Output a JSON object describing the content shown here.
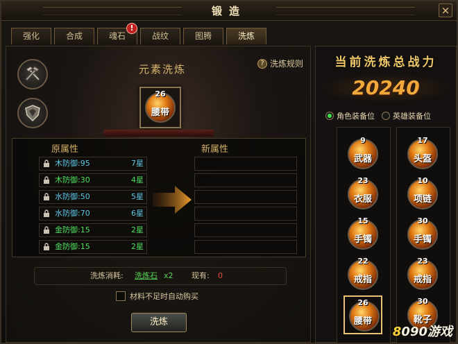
{
  "window": {
    "title": "锻造",
    "close_label": "×"
  },
  "tabs": [
    {
      "label": "强化",
      "active": false
    },
    {
      "label": "合成",
      "active": false
    },
    {
      "label": "魂石",
      "active": false,
      "alert": "!"
    },
    {
      "label": "战纹",
      "active": false
    },
    {
      "label": "图腾",
      "active": false
    },
    {
      "label": "洗炼",
      "active": true
    }
  ],
  "left": {
    "heading": "元素洗炼",
    "rules_q": "?",
    "rules_label": "洗炼规则",
    "center_item": {
      "level": "26",
      "name": "腰带"
    },
    "original_header": "原属性",
    "new_header": "新属性",
    "attributes": [
      {
        "text": "木防御:95",
        "stars": "7星",
        "color": "cyan"
      },
      {
        "text": "木防御:30",
        "stars": "4星",
        "color": "green"
      },
      {
        "text": "水防御:50",
        "stars": "5星",
        "color": "cyan"
      },
      {
        "text": "水防御:70",
        "stars": "6星",
        "color": "cyan"
      },
      {
        "text": "金防御:15",
        "stars": "2星",
        "color": "green"
      },
      {
        "text": "金防御:15",
        "stars": "2星",
        "color": "green"
      }
    ],
    "cost_label": "洗炼消耗:",
    "cost_item": "洗炼石",
    "cost_mult": "x2",
    "own_label": "现有:",
    "own_value": "0",
    "auto_buy_label": "材料不足时自动购买",
    "refine_button": "洗炼"
  },
  "right": {
    "power_title": "当前洗炼总战力",
    "power_value": "20240",
    "radio_role": "角色装备位",
    "radio_hero": "英雄装备位",
    "left_column": [
      {
        "level": "9",
        "name": "武器"
      },
      {
        "level": "23",
        "name": "衣服"
      },
      {
        "level": "15",
        "name": "手镯"
      },
      {
        "level": "22",
        "name": "戒指"
      },
      {
        "level": "26",
        "name": "腰带",
        "selected": true
      }
    ],
    "right_column": [
      {
        "level": "17",
        "name": "头盔"
      },
      {
        "level": "10",
        "name": "项链"
      },
      {
        "level": "30",
        "name": "手镯"
      },
      {
        "level": "23",
        "name": "戒指"
      },
      {
        "level": "30",
        "name": "靴子"
      }
    ]
  },
  "watermark": {
    "eight": "8",
    "rest": "090游戏"
  },
  "colors": {
    "gold": "#f0a93a",
    "cyan": "#5ec8e6",
    "green": "#4ee05e",
    "red": "#e64a3a"
  }
}
